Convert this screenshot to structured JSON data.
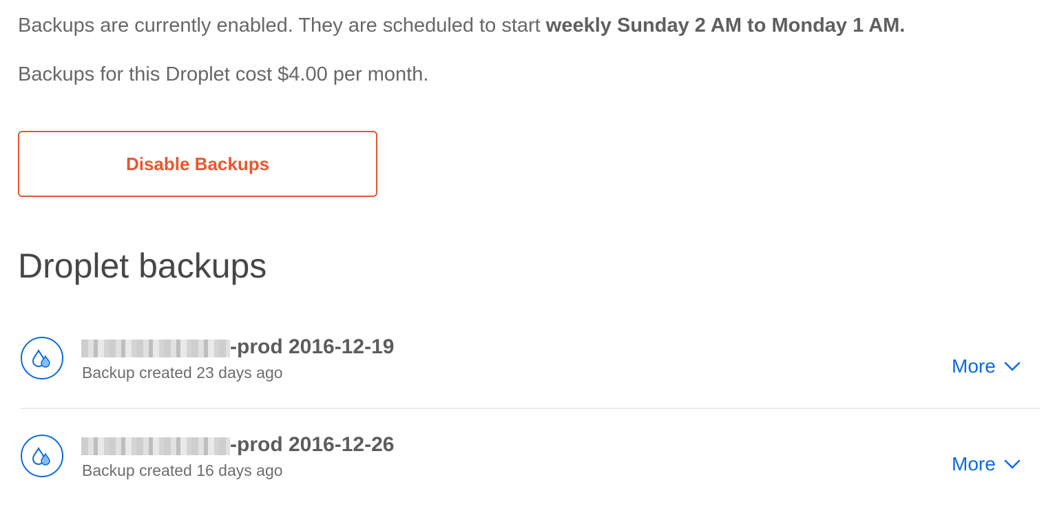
{
  "settings": {
    "status_text": "Backups are currently enabled. They are scheduled to start ",
    "schedule": "weekly Sunday 2 AM to Monday 1 AM.",
    "cost_text": "Backups for this Droplet cost $4.00 per month.",
    "disable_button": "Disable Backups"
  },
  "section": {
    "title": "Droplet backups"
  },
  "backups": [
    {
      "name": "-prod 2016-12-19",
      "meta": "Backup created 23 days ago",
      "more": "More",
      "icon": "droplet-icon"
    },
    {
      "name": "-prod 2016-12-26",
      "meta": "Backup created 16 days ago",
      "more": "More",
      "icon": "droplet-icon"
    }
  ],
  "colors": {
    "accent_blue": "#0a69e1",
    "danger_orange": "#e9562f",
    "text_gray": "#676767"
  }
}
